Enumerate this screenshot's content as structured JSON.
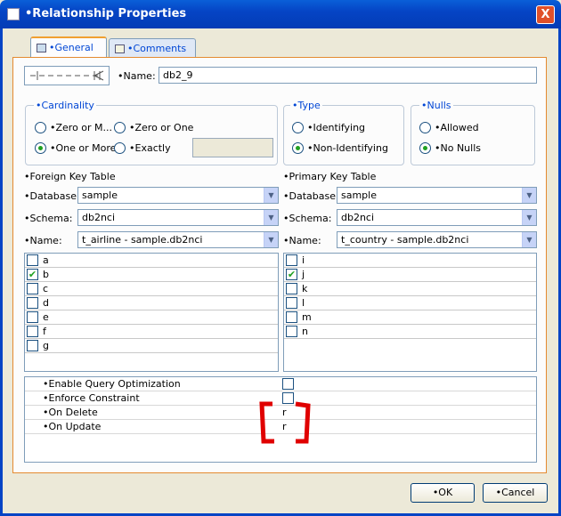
{
  "window": {
    "title": "•Relationship Properties",
    "close_label": "X"
  },
  "tabs": [
    {
      "label": "•General"
    },
    {
      "label": "•Comments"
    }
  ],
  "name_field": {
    "label": "•Name:",
    "value": "db2_9"
  },
  "cardinality": {
    "legend": "•Cardinality",
    "options": [
      "•Zero or M...",
      "•Zero or One",
      "•One or More",
      "•Exactly"
    ],
    "selected": "•One or More",
    "exactly_value": ""
  },
  "type": {
    "legend": "•Type",
    "options": [
      "•Identifying",
      "•Non-Identifying"
    ],
    "selected": "•Non-Identifying"
  },
  "nulls": {
    "legend": "•Nulls",
    "options": [
      "•Allowed",
      "•No Nulls"
    ],
    "selected": "•No Nulls"
  },
  "foreign": {
    "title": "•Foreign Key Table",
    "database_label": "•Database:",
    "database": "sample",
    "schema_label": "•Schema:",
    "schema": "db2nci",
    "name_label": "•Name:",
    "name": "t_airline - sample.db2nci",
    "columns": [
      {
        "name": "a",
        "checked": false
      },
      {
        "name": "b",
        "checked": true
      },
      {
        "name": "c",
        "checked": false
      },
      {
        "name": "d",
        "checked": false
      },
      {
        "name": "e",
        "checked": false
      },
      {
        "name": "f",
        "checked": false
      },
      {
        "name": "g",
        "checked": false
      }
    ]
  },
  "primary": {
    "title": "•Primary Key Table",
    "database_label": "•Database:",
    "database": "sample",
    "schema_label": "•Schema:",
    "schema": "db2nci",
    "name_label": "•Name:",
    "name": "t_country - sample.db2nci",
    "columns": [
      {
        "name": "i",
        "checked": false
      },
      {
        "name": "j",
        "checked": true
      },
      {
        "name": "k",
        "checked": false
      },
      {
        "name": "l",
        "checked": false
      },
      {
        "name": "m",
        "checked": false
      },
      {
        "name": "n",
        "checked": false
      }
    ]
  },
  "properties": [
    {
      "label": "•Enable Query Optimization",
      "value": ""
    },
    {
      "label": "•Enforce Constraint",
      "value": ""
    },
    {
      "label": "•On Delete",
      "value": "r"
    },
    {
      "label": "•On Update",
      "value": "r"
    }
  ],
  "buttons": {
    "ok": "•OK",
    "cancel": "•Cancel"
  },
  "colors": {
    "titlebar": "#0544c5",
    "legend": "#0046d5",
    "annotation": "#e00000",
    "check": "#21a121"
  }
}
